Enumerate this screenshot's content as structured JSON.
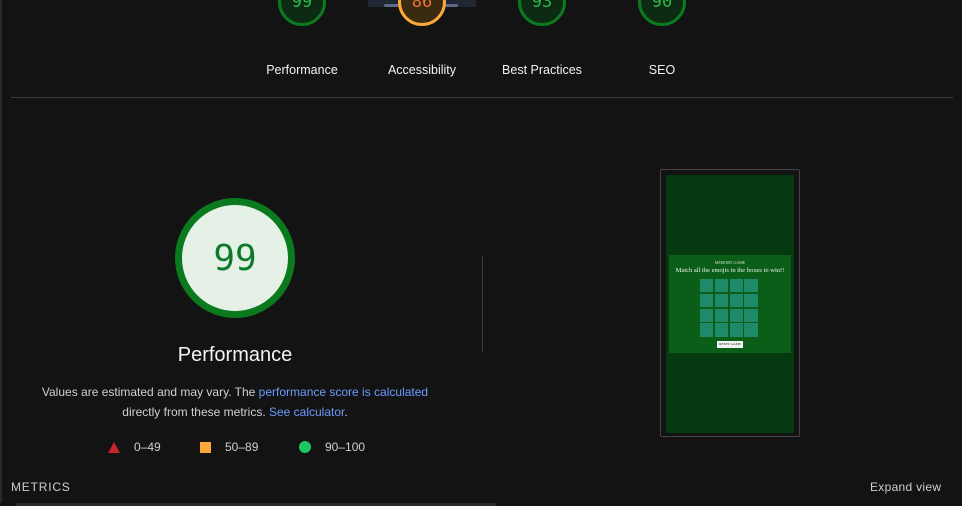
{
  "scores": [
    {
      "value": "99",
      "label": "Performance",
      "status": "good"
    },
    {
      "value": "86",
      "label": "Accessibility",
      "status": "average"
    },
    {
      "value": "93",
      "label": "Best Practices",
      "status": "good"
    },
    {
      "value": "90",
      "label": "SEO",
      "status": "good"
    }
  ],
  "main": {
    "score": "99",
    "title": "Performance",
    "desc_pre": "Values are estimated and may vary. The ",
    "desc_link1": "performance score is calculated",
    "desc_mid": "directly from these metrics. ",
    "desc_link2": "See calculator",
    "desc_end": "."
  },
  "legend": [
    {
      "icon": "triangle-icon",
      "range": "0–49",
      "color": "#c4262e"
    },
    {
      "icon": "square-icon",
      "range": "50–89",
      "color": "#fba73a"
    },
    {
      "icon": "circle-icon",
      "range": "90–100",
      "color": "#1ec861"
    }
  ],
  "screenshot": {
    "game_title": "MEMORY GAME",
    "subtitle": "Match all the emojis in the boxes to win!!",
    "button": "RESET GAME"
  },
  "footer": {
    "metrics_label": "METRICS",
    "expand_label": "Expand view"
  }
}
